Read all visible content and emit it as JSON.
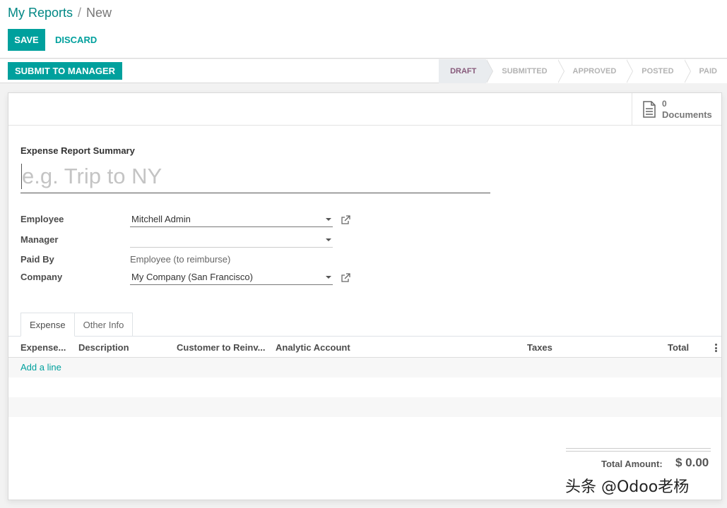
{
  "breadcrumb": {
    "parent": "My Reports",
    "separator": "/",
    "current": "New"
  },
  "actions": {
    "save": "SAVE",
    "discard": "DISCARD"
  },
  "statusbar": {
    "submit": "SUBMIT TO MANAGER",
    "stages": [
      "DRAFT",
      "SUBMITTED",
      "APPROVED",
      "POSTED",
      "PAID"
    ],
    "active_stage": "DRAFT"
  },
  "documents": {
    "count": "0",
    "label": "Documents",
    "icon": "document-icon"
  },
  "form": {
    "summary_label": "Expense Report Summary",
    "summary_placeholder": "e.g. Trip to NY",
    "employee_label": "Employee",
    "employee_value": "Mitchell Admin",
    "manager_label": "Manager",
    "manager_value": "",
    "paid_by_label": "Paid By",
    "paid_by_value": "Employee (to reimburse)",
    "company_label": "Company",
    "company_value": "My Company (San Francisco)"
  },
  "tabs": [
    "Expense",
    "Other Info"
  ],
  "table": {
    "columns": [
      "Expense...",
      "Description",
      "Customer to Reinv...",
      "Analytic Account",
      "Taxes",
      "Total"
    ],
    "add_line": "Add a line"
  },
  "totals": {
    "label": "Total Amount:",
    "value": "$ 0.00"
  },
  "watermark": "头条 @Odoo老杨",
  "colors": {
    "primary": "#00a09d",
    "link": "#008784",
    "active_stage": "#875a7b"
  }
}
